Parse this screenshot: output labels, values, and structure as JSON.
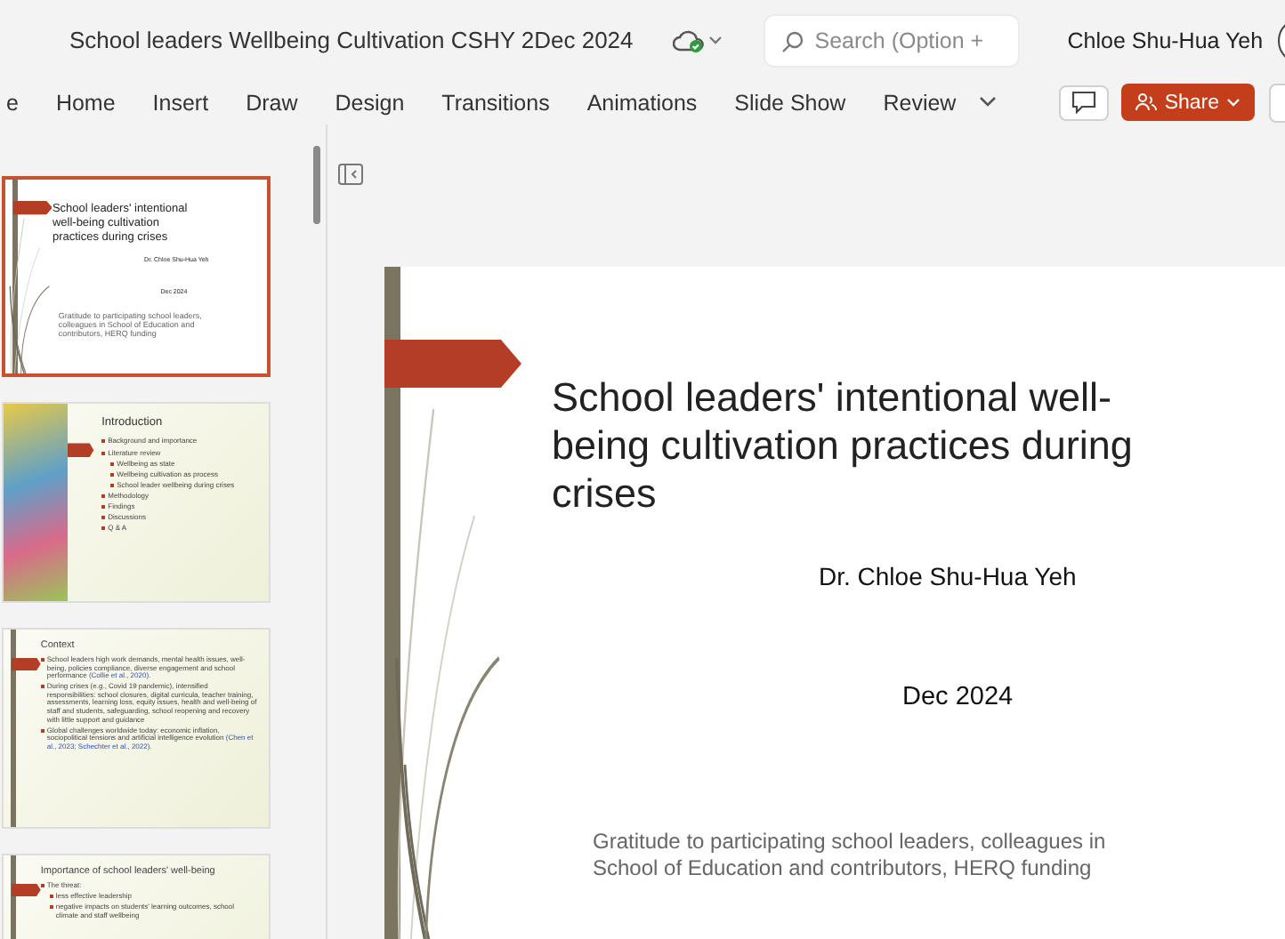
{
  "app": {
    "title": "School leaders Wellbeing Cultivation CSHY 2Dec 2024",
    "search": {
      "placeholder": "Search (Option +"
    },
    "user": "Chloe Shu-Hua Yeh"
  },
  "ribbon": {
    "tabs": [
      {
        "label": "e"
      },
      {
        "label": "Home"
      },
      {
        "label": "Insert"
      },
      {
        "label": "Draw"
      },
      {
        "label": "Design"
      },
      {
        "label": "Transitions"
      },
      {
        "label": "Animations"
      },
      {
        "label": "Slide Show"
      },
      {
        "label": "Review"
      }
    ],
    "share": "Share"
  },
  "slides": [
    {
      "kind": "title",
      "selected": true,
      "title": "School leaders' intentional well-being cultivation practices during crises",
      "author": "Dr. Chloe Shu-Hua Yeh",
      "date": "Dec 2024",
      "note": "Gratitude to participating school leaders, colleagues in School of Education and contributors, HERQ funding"
    },
    {
      "kind": "agenda",
      "selected": false,
      "title": "Introduction",
      "items": [
        {
          "text": "Background and importance"
        },
        {
          "text": "Literature review",
          "children": [
            {
              "text": "Wellbeing as state"
            },
            {
              "text": "Wellbeing cultivation as process"
            },
            {
              "text": "School leader wellbeing during crises"
            }
          ]
        },
        {
          "text": "Methodology"
        },
        {
          "text": "Findings"
        },
        {
          "text": "Discussions"
        },
        {
          "text": "Q & A"
        }
      ]
    },
    {
      "kind": "bullets",
      "selected": false,
      "title": "Context",
      "items": [
        {
          "text": "School leaders high work demands, mental health issues, well-being, policies compliance, diverse engagement and school performance",
          "citation": "(Collie et al., 2020)."
        },
        {
          "text": "During crises (e.g., Covid 19 pandemic), intensified responsibilities: school closures, digital curricula, teacher training, assessments, learning loss, equity issues, health and well-being of staff and students, safeguarding, school reopening and recovery with little support and guidance"
        },
        {
          "text": "Global challenges worldwide today: economic inflation, sociopolitical tensions and artificial intelligence evolution",
          "citation": "(Chen et al., 2023; Schechter et al., 2022)."
        }
      ]
    },
    {
      "kind": "bullets",
      "selected": false,
      "title": "Importance of school leaders' well-being",
      "items": [
        {
          "text": "The threat:",
          "children": [
            {
              "text": "less effective leadership"
            },
            {
              "text": "negative impacts on students' learning outcomes, school climate and staff wellbeing"
            }
          ]
        }
      ]
    }
  ],
  "editor": {
    "title": "School leaders' intentional well-being cultivation practices during crises",
    "author": "Dr. Chloe Shu-Hua Yeh",
    "date": "Dec 2024",
    "note": "Gratitude to participating school leaders, colleagues in School of Education and contributors, HERQ funding"
  }
}
